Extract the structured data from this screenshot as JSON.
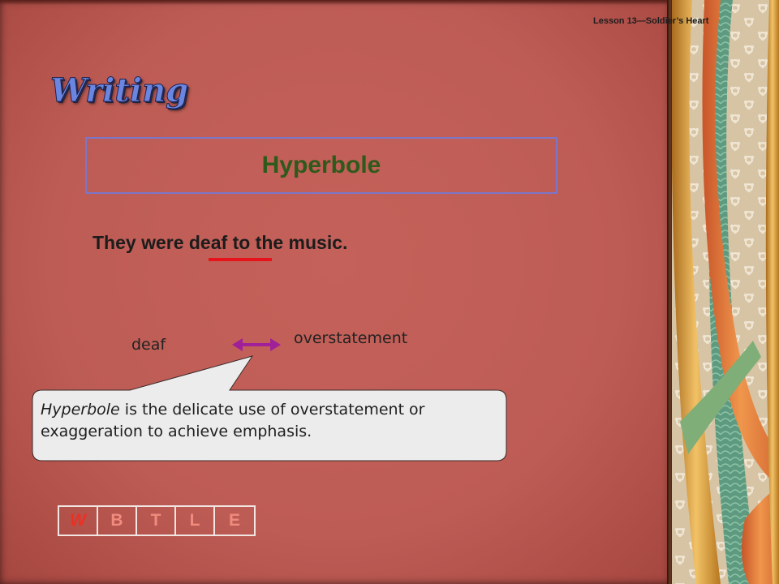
{
  "header": {
    "lesson": "Lesson 13—Soldier’s Heart"
  },
  "slide": {
    "heading": "Writing",
    "title": "Hyperbole",
    "sentence": "They were deaf to the music.",
    "term": "deaf",
    "meaning": "overstatement",
    "callout": {
      "term": "Hyperbole",
      "definition": " is the delicate use of overstatement or exaggeration to achieve emphasis."
    }
  },
  "nav": {
    "items": [
      {
        "label": "W",
        "active": true
      },
      {
        "label": "B",
        "active": false
      },
      {
        "label": "T",
        "active": false
      },
      {
        "label": "L",
        "active": false
      },
      {
        "label": "E",
        "active": false
      }
    ]
  },
  "colors": {
    "slide_bg": "#bd5c55",
    "accent_underline": "#e8121a",
    "arrow": "#a0209a",
    "title_green": "#2e5a1b"
  }
}
